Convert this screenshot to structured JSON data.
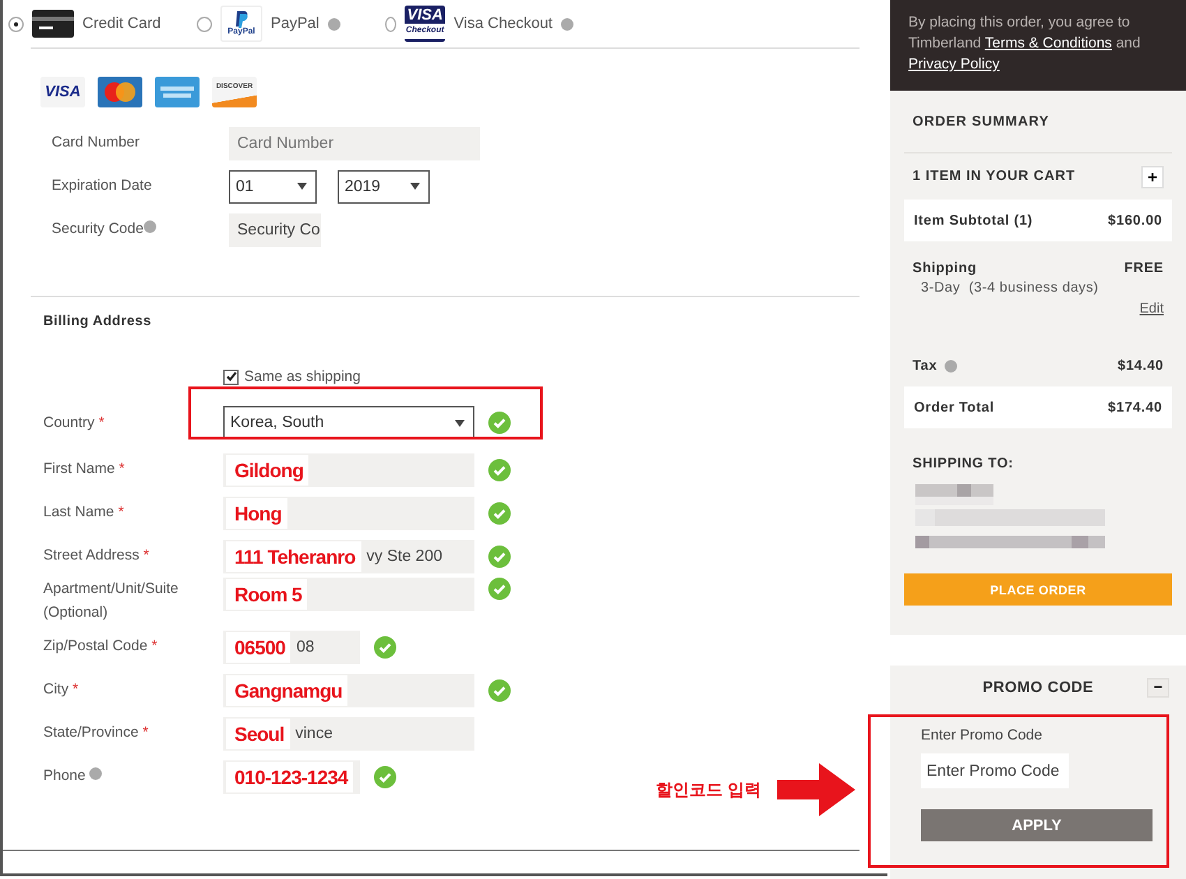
{
  "payment_methods": [
    {
      "kind": "card",
      "label": "Credit Card",
      "selected": true,
      "info": false
    },
    {
      "kind": "paypal",
      "label": "PayPal",
      "logo_text": "PayPal",
      "selected": false,
      "info": true
    },
    {
      "kind": "visa_checkout",
      "label": "Visa Checkout",
      "logo_text": "VISA",
      "logo_subtext": "Checkout",
      "selected": false,
      "info": true
    }
  ],
  "card_logos": [
    {
      "kind": "visa",
      "text": "VISA"
    },
    {
      "kind": "mastercard"
    },
    {
      "kind": "amex"
    },
    {
      "kind": "discover",
      "text": "DISCOVER"
    }
  ],
  "card_form": {
    "card_number": {
      "label": "Card Number",
      "placeholder": "Card Number"
    },
    "expiration": {
      "label": "Expiration Date",
      "month": "01",
      "year": "2019"
    },
    "security_code": {
      "label": "Security Code",
      "placeholder": "Security Co",
      "info": true
    }
  },
  "billing": {
    "title": "Billing Address",
    "same_as_shipping": {
      "label": "Same as shipping",
      "checked": true
    },
    "fields": [
      {
        "kind": "select",
        "label": "Country",
        "required_mark": "*",
        "value": "Korea, South",
        "valid": true,
        "highlighted": true
      },
      {
        "kind": "text",
        "label": "First Name",
        "required_mark": "*",
        "annotation": "Gildong",
        "valid": true
      },
      {
        "kind": "text",
        "label": "Last Name",
        "required_mark": "*",
        "annotation": "Hong",
        "valid": true
      },
      {
        "kind": "text",
        "label": "Street Address",
        "required_mark": "*",
        "annotation": "111 Teheranro",
        "value": "vy Ste 200",
        "valid": true
      },
      {
        "kind": "text",
        "label": "Apartment/Unit/Suite (Optional)",
        "annotation": "Room 5",
        "valid": true
      },
      {
        "kind": "short_text",
        "label": "Zip/Postal Code",
        "required_mark": "*",
        "annotation": "06500",
        "value": "08",
        "valid": true
      },
      {
        "kind": "text",
        "label": "City",
        "required_mark": "*",
        "annotation": "Gangnamgu",
        "valid": true
      },
      {
        "kind": "text",
        "label": "State/Province",
        "required_mark": "*",
        "annotation": "Seoul",
        "value": "vince",
        "valid": false
      },
      {
        "kind": "short_text",
        "label": "Phone",
        "info": true,
        "annotation": "010-123-1234",
        "valid": true
      }
    ]
  },
  "agreement": {
    "text": "By placing this order, you agree to Timberland",
    "terms_link": "Terms & Conditions",
    "joiner": "and",
    "privacy_link": "Privacy Policy"
  },
  "order_summary": {
    "title": "ORDER SUMMARY",
    "cart": {
      "label": "1 ITEM IN YOUR CART",
      "toggle": "+"
    },
    "subtotal": {
      "label": "Item Subtotal (1)",
      "value": "$160.00"
    },
    "shipping": {
      "label": "Shipping",
      "value": "FREE",
      "method": "3-Day  (3-4 business days)",
      "edit": "Edit"
    },
    "tax": {
      "label": "Tax",
      "value": "$14.40"
    },
    "total": {
      "label": "Order Total",
      "value": "$174.40"
    },
    "shipping_to": {
      "title": "SHIPPING TO:"
    },
    "place_order": "PLACE ORDER"
  },
  "promo": {
    "title": "PROMO CODE",
    "toggle": "−",
    "field_label": "Enter Promo Code",
    "placeholder": "Enter Promo Code",
    "apply": "APPLY",
    "highlighted": true
  },
  "callout": {
    "text": "할인코드 입력"
  }
}
